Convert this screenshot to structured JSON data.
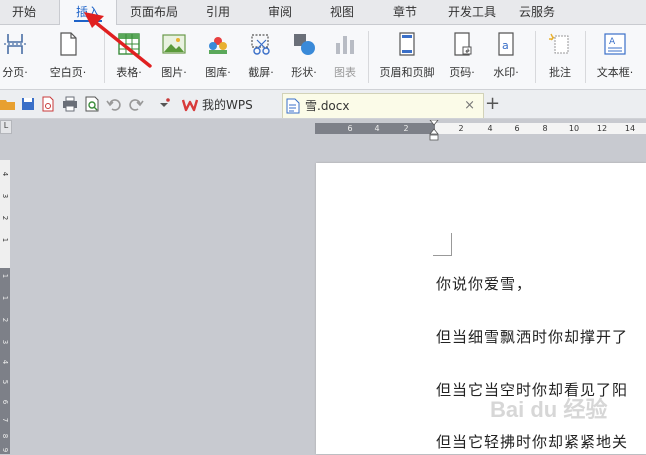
{
  "menu": {
    "tabs": [
      {
        "label": "开始"
      },
      {
        "label": "插入"
      },
      {
        "label": "页面布局"
      },
      {
        "label": "引用"
      },
      {
        "label": "审阅"
      },
      {
        "label": "视图"
      },
      {
        "label": "章节"
      },
      {
        "label": "开发工具"
      },
      {
        "label": "云服务"
      }
    ],
    "active": "插入"
  },
  "ribbon": {
    "buttons": [
      {
        "label": "分页·",
        "icon": "page-break-icon"
      },
      {
        "label": "空白页·",
        "icon": "blank-page-icon"
      },
      {
        "label": "表格·",
        "icon": "table-icon"
      },
      {
        "label": "图片·",
        "icon": "picture-icon"
      },
      {
        "label": "图库·",
        "icon": "gallery-icon"
      },
      {
        "label": "截屏·",
        "icon": "screenshot-icon"
      },
      {
        "label": "形状·",
        "icon": "shape-icon"
      },
      {
        "label": "图表",
        "icon": "chart-icon"
      },
      {
        "label": "页眉和页脚",
        "icon": "header-footer-icon"
      },
      {
        "label": "页码·",
        "icon": "page-number-icon"
      },
      {
        "label": "水印·",
        "icon": "watermark-icon"
      },
      {
        "label": "批注",
        "icon": "comment-icon"
      },
      {
        "label": "文本框·",
        "icon": "textbox-icon"
      }
    ]
  },
  "tabs": {
    "wps": {
      "label": "我的WPS"
    },
    "doc": {
      "label": "雪.docx",
      "close": "×"
    },
    "add": "+"
  },
  "ruler": {
    "corner": "L",
    "h_ticks": [
      "6",
      "4",
      "2",
      "2",
      "4",
      "6",
      "8",
      "10",
      "12",
      "14"
    ],
    "v_ticks": [
      "4",
      "3",
      "2",
      "1",
      "1",
      "1",
      "2",
      "3",
      "4",
      "5",
      "6",
      "7",
      "8",
      "9"
    ]
  },
  "document": {
    "lines": [
      "你说你爱雪，",
      "但当细雪飘洒时你却撑开了",
      "但当它当空时你却看见了阳",
      "但当它轻拂时你却紧紧地关"
    ]
  },
  "watermark": "Bai du 经验",
  "colors": {
    "accent": "#1e63c8",
    "arrow": "#e02020",
    "menubar": "#e8e9ec",
    "ribbon": "#f7f8fa",
    "doc_tab": "#fbfbe8"
  }
}
